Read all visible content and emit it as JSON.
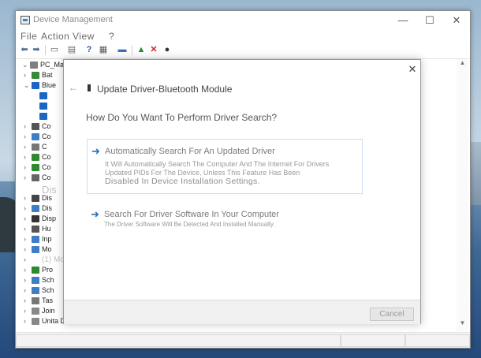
{
  "window": {
    "title": "Device Management",
    "controls": {
      "minimize": "—",
      "maximize": "☐",
      "close": "✕"
    }
  },
  "menu": [
    "File",
    "Action",
    "View",
    "?"
  ],
  "toolbar": {
    "icons": [
      "back-icon",
      "forward-icon",
      "properties-icon",
      "list-icon",
      "help-icon",
      "details-icon",
      "monitor-icon",
      "update-driver-icon",
      "uninstall-icon",
      "enable-icon"
    ]
  },
  "tree": [
    {
      "arrow": "⌄",
      "label": "PC_Ma",
      "color": "#7f7f7f"
    },
    {
      "arrow": "›",
      "label": "Bat",
      "color": "#3b8a3b"
    },
    {
      "arrow": "⌄",
      "label": "Blue",
      "color": "#1b66c2"
    },
    {
      "arrow": "",
      "label": "",
      "color": "#1b66c2"
    },
    {
      "arrow": "",
      "label": "",
      "color": "#1b66c2"
    },
    {
      "arrow": "",
      "label": "",
      "color": "#1b66c2"
    },
    {
      "arrow": "›",
      "label": "Co",
      "color": "#555555"
    },
    {
      "arrow": "›",
      "label": "Co",
      "color": "#3d7ec6"
    },
    {
      "arrow": "›",
      "label": "C",
      "color": "#777777"
    },
    {
      "arrow": "›",
      "label": "Co",
      "color": "#2e8a2e"
    },
    {
      "arrow": "›",
      "label": "Co",
      "color": "#2e8a2e"
    },
    {
      "arrow": "›",
      "label": "Co",
      "color": "#666666"
    },
    {
      "arrow": "",
      "label": "Dis",
      "color": "#ffffff"
    },
    {
      "arrow": "›",
      "label": "Dis",
      "color": "#444444"
    },
    {
      "arrow": "›",
      "label": "Dis",
      "color": "#3d7ec6"
    },
    {
      "arrow": "›",
      "label": "Disp",
      "color": "#333333"
    },
    {
      "arrow": "›",
      "label": "Hu",
      "color": "#555555"
    },
    {
      "arrow": "›",
      "label": "Inp",
      "color": "#3d7ec6"
    },
    {
      "arrow": "›",
      "label": "Mo",
      "color": "#3d7ec6"
    },
    {
      "arrow": "›",
      "label": "(1) Mo",
      "color": "#ffffff"
    },
    {
      "arrow": "›",
      "label": "Pro",
      "color": "#2e8a2e"
    },
    {
      "arrow": "›",
      "label": "Sch",
      "color": "#3d7ec6"
    },
    {
      "arrow": "›",
      "label": "Sch",
      "color": "#3d7ec6"
    },
    {
      "arrow": "›",
      "label": "Tas",
      "color": "#777777"
    },
    {
      "arrow": "›",
      "label": "Join",
      "color": "#888888"
    },
    {
      "arrow": "›",
      "label": "Unita DVD/CD-ROM",
      "color": "#888888"
    }
  ],
  "dialog": {
    "title": "Update Driver-Bluetooth Module",
    "question": "How Do You Want To Perform Driver Search?",
    "option1": {
      "heading": "Automatically Search For An Updated Driver",
      "desc1": "It Will Automatically Search The Computer And The Internet For Drivers",
      "desc2": "Updated PIDs For The Device, Unless This Feature Has Been",
      "desc3": "Disabled In Device Installation Settings."
    },
    "option2": {
      "heading": "Search For Driver Software In Your Computer",
      "desc1": "The Driver Software Will Be Detected And Installed Manually."
    },
    "cancel": "Cancel",
    "close": "✕",
    "back": "←"
  },
  "scrollbar": {
    "up": "▲",
    "down": "▼"
  }
}
